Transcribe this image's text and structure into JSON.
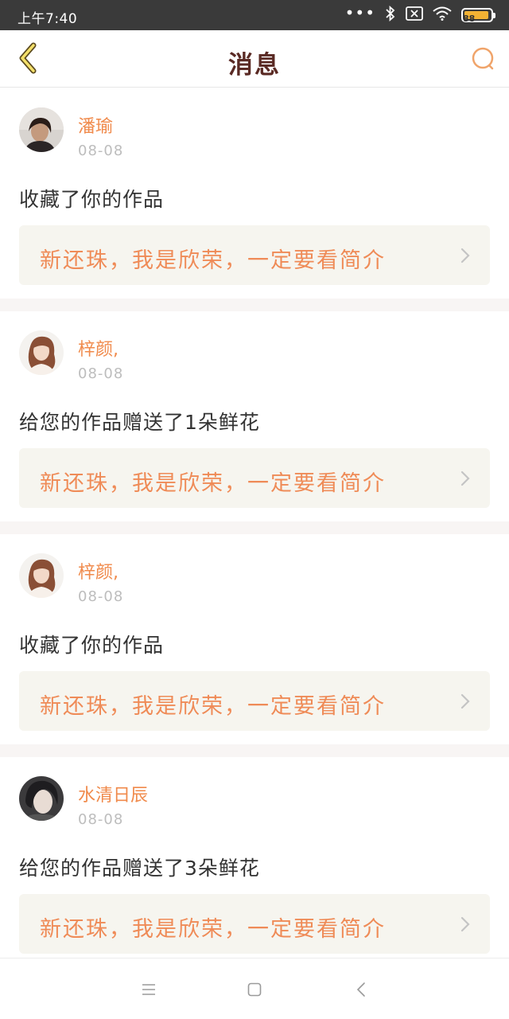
{
  "status_bar": {
    "time": "上午7:40",
    "battery": "88",
    "icons": [
      "more-dots-icon",
      "bluetooth-icon",
      "sim-x-icon",
      "wifi-icon",
      "battery-icon"
    ],
    "battery_color": "#f2b233"
  },
  "header": {
    "title": "消息",
    "back_icon": "chevron-left-icon",
    "search_icon": "search-icon",
    "title_color": "#5a2a24",
    "accent_color": "#f08a4b"
  },
  "messages": [
    {
      "user": "潘瑜",
      "date": "08-08",
      "text": "收藏了你的作品",
      "work_title": "新还珠，我是欣荣，一定要看简介"
    },
    {
      "user": "梓颜,",
      "date": "08-08",
      "text": "给您的作品赠送了1朵鲜花",
      "work_title": "新还珠，我是欣荣，一定要看简介"
    },
    {
      "user": "梓颜,",
      "date": "08-08",
      "text": "收藏了你的作品",
      "work_title": "新还珠，我是欣荣，一定要看简介"
    },
    {
      "user": "水清日辰",
      "date": "08-08",
      "text": "给您的作品赠送了3朵鲜花",
      "work_title": "新还珠，我是欣荣，一定要看简介"
    }
  ],
  "nav_bar": {
    "icons": [
      "menu-icon",
      "home-square-icon",
      "back-triangle-icon"
    ]
  }
}
